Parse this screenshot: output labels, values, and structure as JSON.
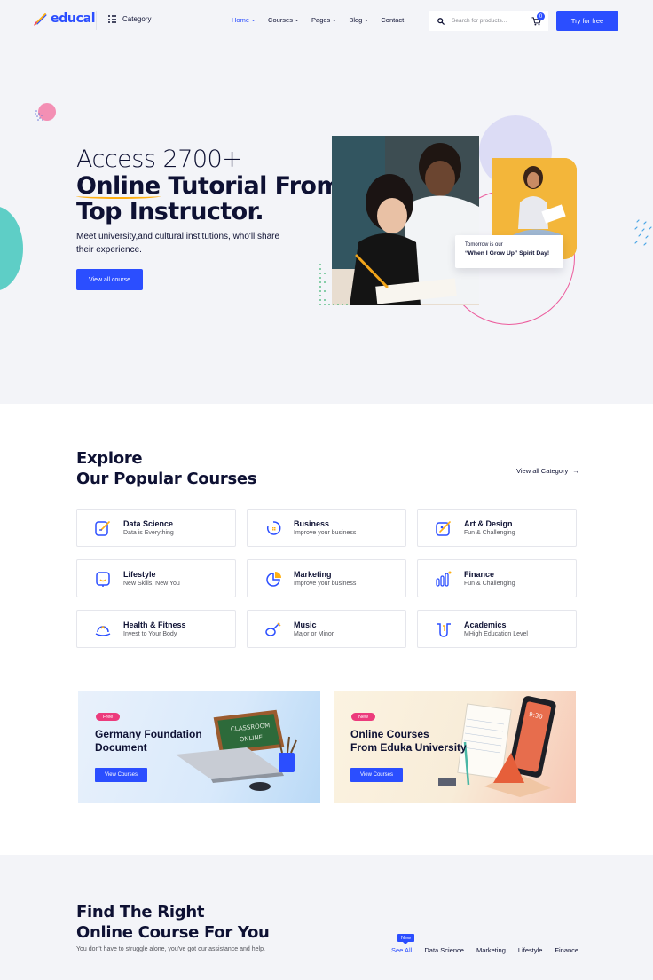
{
  "header": {
    "logo": "educal",
    "category": "Category",
    "nav": [
      {
        "label": "Home",
        "active": true
      },
      {
        "label": "Courses"
      },
      {
        "label": "Pages"
      },
      {
        "label": "Blog"
      },
      {
        "label": "Contact"
      }
    ],
    "search_placeholder": "Search for products...",
    "cart_count": "0",
    "cta": "Try for free"
  },
  "hero": {
    "line1": "Access 2700+",
    "line2a": "Online",
    "line2b": " Tutorial From",
    "line3": "Top Instructor.",
    "subtitle": "Meet university,and cultural institutions, who'll share their experience.",
    "button": "View all course",
    "card_small": "Tomorrow is our",
    "card_bold": "“When I Grow Up” Spirit Day!"
  },
  "explore": {
    "title1": "Explore",
    "title2a": "Our ",
    "title2b": "Popular",
    "title2c": " Courses",
    "view_all": "View all Category",
    "categories": [
      {
        "title": "Data Science",
        "sub": "Data is Everything",
        "icon": "data-science-icon"
      },
      {
        "title": "Business",
        "sub": "Improve your business",
        "icon": "business-icon"
      },
      {
        "title": "Art & Design",
        "sub": "Fun & Challenging",
        "icon": "art-design-icon"
      },
      {
        "title": "Lifestyle",
        "sub": "New Skills, New You",
        "icon": "lifestyle-icon"
      },
      {
        "title": "Marketing",
        "sub": "Improve your business",
        "icon": "marketing-icon"
      },
      {
        "title": "Finance",
        "sub": "Fun & Challenging",
        "icon": "finance-icon"
      },
      {
        "title": "Health & Fitness",
        "sub": "Invest to Your Body",
        "icon": "health-icon"
      },
      {
        "title": "Music",
        "sub": "Major or Minor",
        "icon": "music-icon"
      },
      {
        "title": "Academics",
        "sub": "MHigh Education Level",
        "icon": "academics-icon"
      }
    ],
    "banners": [
      {
        "badge": "Free",
        "title_l1": "Germany Foundation",
        "title_l2": "Document",
        "button": "View Courses",
        "chalkboard_l1": "CLASSROOM",
        "chalkboard_l2": "ONLINE"
      },
      {
        "badge": "New",
        "title_l1": "Online Courses",
        "title_l2": "From Eduka University",
        "button": "View Courses",
        "phone_time": "9:30"
      }
    ]
  },
  "find": {
    "title1": "Find The Right",
    "title2a": "Online ",
    "title2b": "Course",
    "title2c": " For You",
    "subtitle": "You don't have to struggle alone, you've got our assistance and help.",
    "new_tag": "New",
    "tabs": [
      "See All",
      "Data Science",
      "Marketing",
      "Lifestyle",
      "Finance"
    ]
  },
  "colors": {
    "primary": "#2b4eff",
    "accent_underline": "#ffb013",
    "pink": "#ec3b7c",
    "teal": "#43c7bd",
    "text": "#0e1133"
  }
}
